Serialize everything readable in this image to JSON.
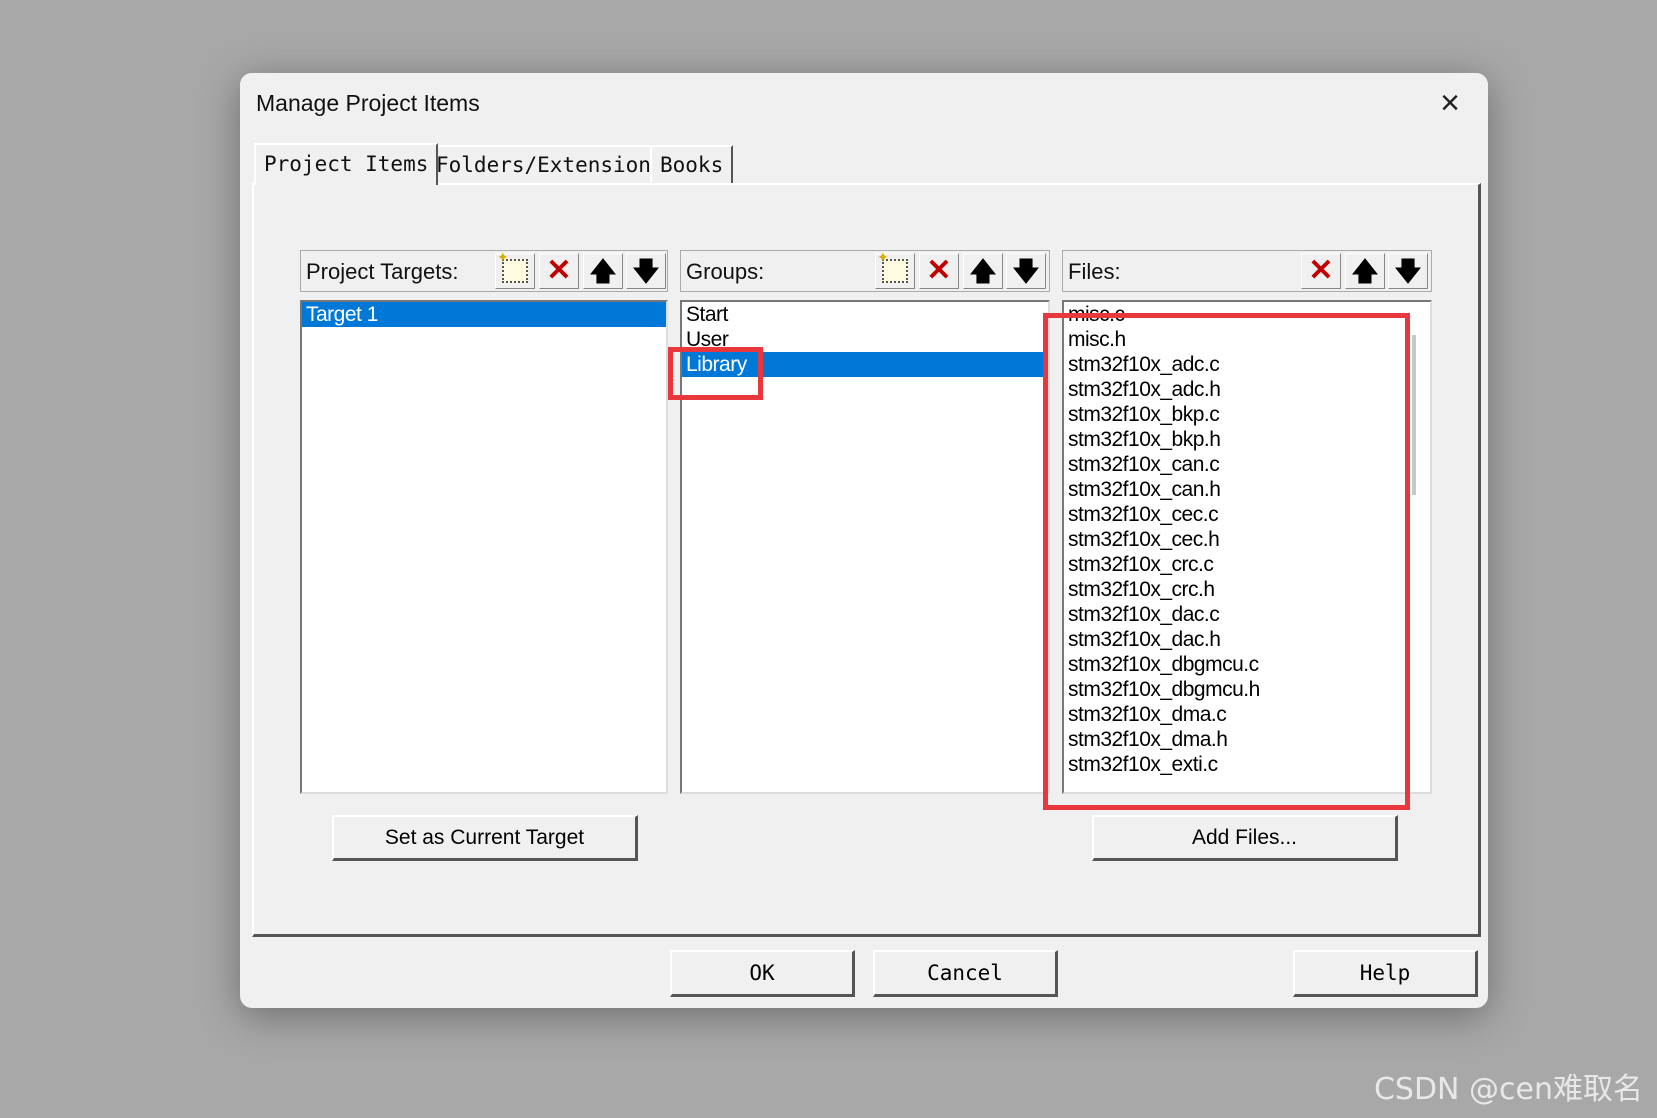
{
  "dialog": {
    "title": "Manage Project Items",
    "close_icon": "×"
  },
  "tabs": [
    {
      "label": "Project Items",
      "active": true
    },
    {
      "label": "Folders/Extensions",
      "active": false
    },
    {
      "label": "Books",
      "active": false
    }
  ],
  "targets": {
    "header": "Project Targets:",
    "items": [
      "Target 1"
    ],
    "selected": "Target 1",
    "set_current_button": "Set as Current Target"
  },
  "groups": {
    "header": "Groups:",
    "items": [
      "Start",
      "User",
      "Library"
    ],
    "selected": "Library"
  },
  "files": {
    "header": "Files:",
    "items": [
      "misc.c",
      "misc.h",
      "stm32f10x_adc.c",
      "stm32f10x_adc.h",
      "stm32f10x_bkp.c",
      "stm32f10x_bkp.h",
      "stm32f10x_can.c",
      "stm32f10x_can.h",
      "stm32f10x_cec.c",
      "stm32f10x_cec.h",
      "stm32f10x_crc.c",
      "stm32f10x_crc.h",
      "stm32f10x_dac.c",
      "stm32f10x_dac.h",
      "stm32f10x_dbgmcu.c",
      "stm32f10x_dbgmcu.h",
      "stm32f10x_dma.c",
      "stm32f10x_dma.h",
      "stm32f10x_exti.c"
    ],
    "add_button": "Add Files..."
  },
  "toolbar_icons": {
    "new": "new-item-icon",
    "delete": "delete-icon",
    "up": "move-up-icon",
    "down": "move-down-icon",
    "delete_glyph": "✕",
    "up_glyph": "🡅",
    "down_glyph": "🡇"
  },
  "footer": {
    "ok": "OK",
    "cancel": "Cancel",
    "help": "Help"
  },
  "highlight_color": "#e8383d",
  "selection_color": "#0078d7",
  "watermark": "CSDN @cen难取名"
}
